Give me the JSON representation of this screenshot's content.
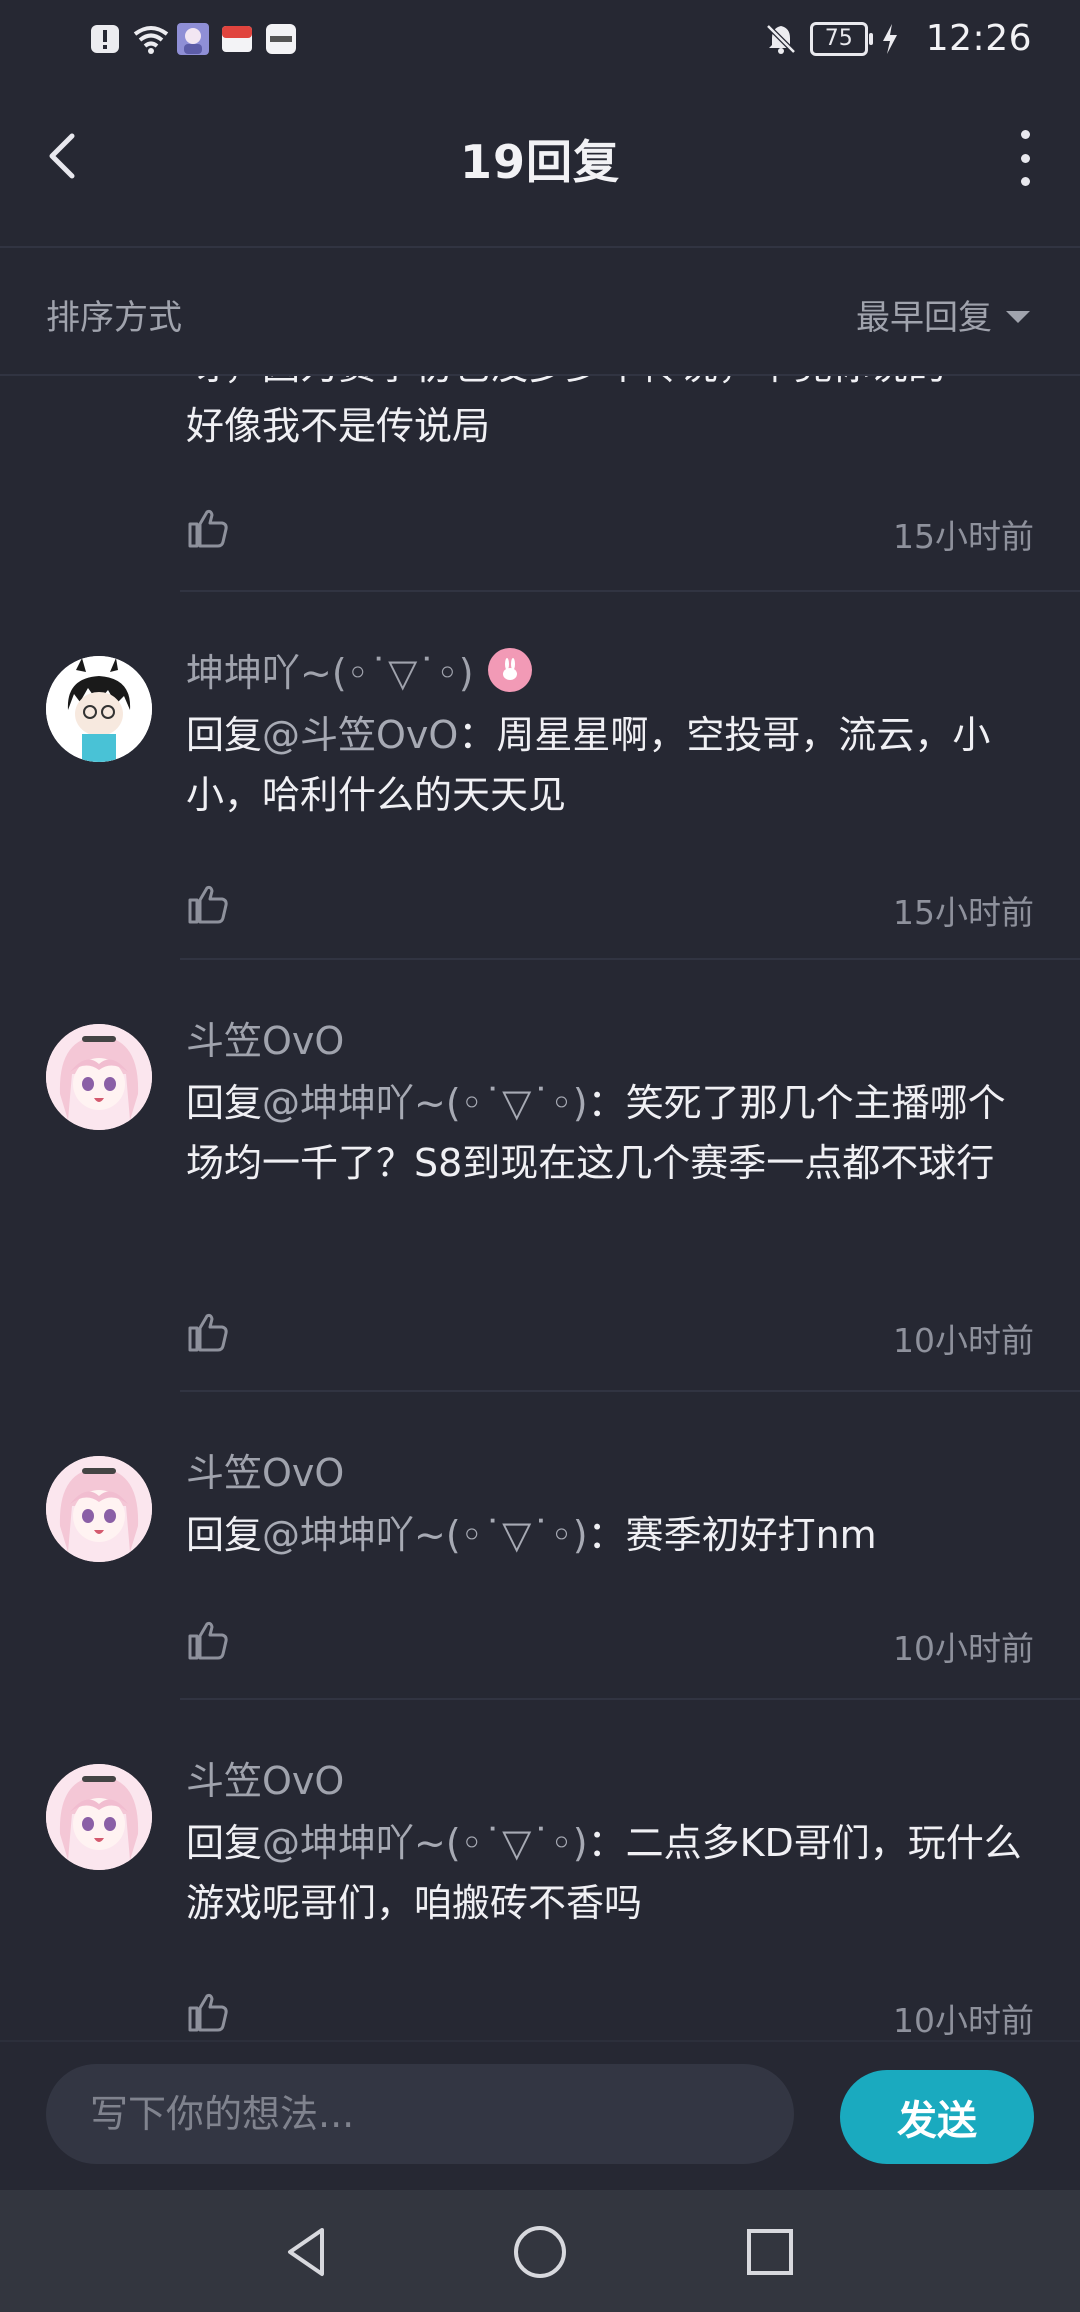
{
  "status_bar": {
    "time": "12:26",
    "battery": "75",
    "icons": [
      "alert-icon",
      "wifi-icon",
      "app-avatar-icon",
      "app-store-icon",
      "huawei-app-icon",
      "bell-muted-icon",
      "charging-icon"
    ]
  },
  "header": {
    "title": "19回复"
  },
  "sort": {
    "label": "排序方式",
    "value": "最早回复"
  },
  "cut_comment": {
    "line1": "呀，因为赛季初也没多少个传说，毕竟你说的",
    "line2": "好像我不是传说局",
    "time": "15小时前"
  },
  "comments": [
    {
      "user": "坤坤吖~(◦˙▽˙◦)",
      "mention": "@斗笠OvO",
      "prefix": "回复",
      "sep": "：",
      "text": "周星星啊，空投哥，流云，小小，哈利什么的天天见",
      "time": "15小时前",
      "avatar": "boy-avatar"
    },
    {
      "user": "斗笠OvO",
      "mention": "@坤坤吖~(◦˙▽˙◦)",
      "prefix": "回复",
      "sep": "：",
      "text": "笑死了那几个主播哪个场均一千了？S8到现在这几个赛季一点都不球行",
      "time": "10小时前",
      "avatar": "girl-avatar"
    },
    {
      "user": "斗笠OvO",
      "mention": "@坤坤吖~(◦˙▽˙◦)",
      "prefix": "回复",
      "sep": "：",
      "text": "赛季初好打nm",
      "time": "10小时前",
      "avatar": "girl-avatar"
    },
    {
      "user": "斗笠OvO",
      "mention": "@坤坤吖~(◦˙▽˙◦)",
      "prefix": "回复",
      "sep": "：",
      "text": "二点多KD哥们，玩什么游戏呢哥们，咱搬砖不香吗",
      "time": "10小时前",
      "avatar": "girl-avatar"
    }
  ],
  "input": {
    "placeholder": "写下你的想法...",
    "send_label": "发送"
  },
  "colors": {
    "background": "#262833",
    "accent": "#1aaabf",
    "badge": "#f29ab6"
  }
}
